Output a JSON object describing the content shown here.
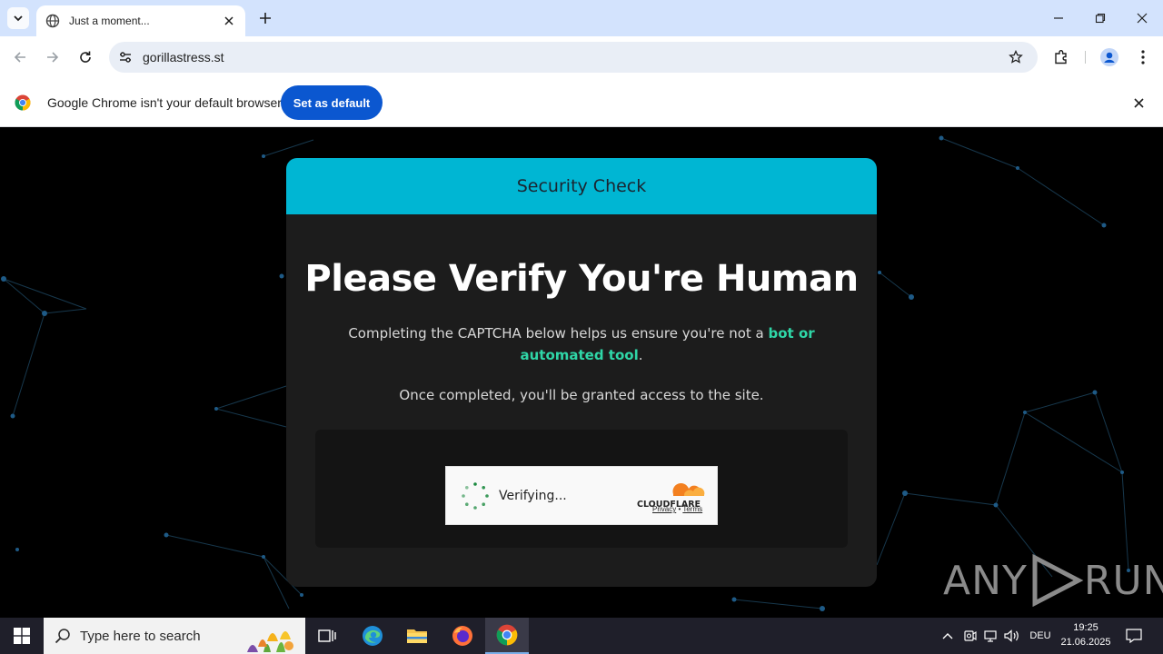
{
  "browser": {
    "tab_title": "Just a moment...",
    "url": "gorillastress.st"
  },
  "infobar": {
    "message": "Google Chrome isn't your default browser",
    "button": "Set as default"
  },
  "card": {
    "header": "Security Check",
    "headline": "Please Verify You're Human",
    "para1_prefix": "Completing the CAPTCHA below helps us ensure you're not a ",
    "para1_highlight": "bot or automated tool",
    "para1_suffix": ".",
    "para2": "Once completed, you'll be granted access to the site."
  },
  "captcha": {
    "status": "Verifying...",
    "brand": "CLOUDFLARE",
    "privacy": "Privacy",
    "separator": "•",
    "terms": "Terms"
  },
  "watermark": {
    "text_left": "ANY",
    "text_right": "RUN"
  },
  "taskbar": {
    "search_placeholder": "Type here to search",
    "language": "DEU",
    "time": "19:25",
    "date": "21.06.2025"
  },
  "colors": {
    "accent_header": "#00b6d3",
    "highlight": "#2fd6a7",
    "chrome_blue": "#0b57d0",
    "cloudflare_orange": "#f38020"
  }
}
